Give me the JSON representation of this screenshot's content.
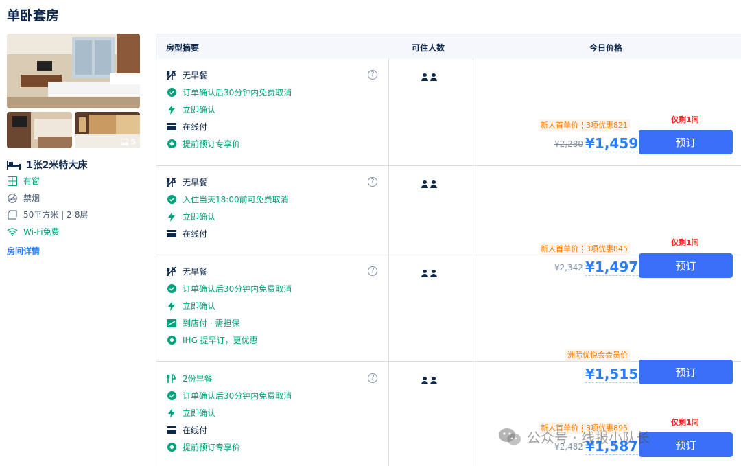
{
  "room": {
    "title": "单卧套房",
    "photo_count": "5",
    "bed": "1张2米特大床",
    "features": [
      "有窗",
      "禁烟",
      "50平方米 | 2-8层",
      "Wi-Fi免费"
    ],
    "detail_link": "房间详情"
  },
  "table": {
    "headers": [
      "房型摘要",
      "可住人数",
      "今日价格"
    ]
  },
  "rates": [
    {
      "policies": [
        {
          "icon": "no-breakfast-icon",
          "text": "无早餐",
          "style": "dark"
        },
        {
          "icon": "check-circle-icon",
          "text": "订单确认后30分钟内免费取消",
          "style": "green"
        },
        {
          "icon": "lightning-icon",
          "text": "立即确认",
          "style": "green"
        },
        {
          "icon": "card-icon",
          "text": "在线付",
          "style": "dark"
        },
        {
          "icon": "coupon-icon",
          "text": "提前预订专享价",
          "style": "green"
        }
      ],
      "promo": [
        "新人首单价",
        "3项优惠821"
      ],
      "original_price": "¥2,280",
      "price": "¥1,459",
      "rooms_left": "仅剩1间",
      "book": "预订"
    },
    {
      "policies": [
        {
          "icon": "no-breakfast-icon",
          "text": "无早餐",
          "style": "dark"
        },
        {
          "icon": "check-circle-icon",
          "text": "入住当天18:00前可免费取消",
          "style": "green"
        },
        {
          "icon": "lightning-icon",
          "text": "立即确认",
          "style": "green"
        },
        {
          "icon": "card-icon",
          "text": "在线付",
          "style": "dark"
        }
      ],
      "promo": [
        "新人首单价",
        "3项优惠845"
      ],
      "original_price": "¥2,342",
      "price": "¥1,497",
      "rooms_left": "仅剩1间",
      "book": "预订"
    },
    {
      "policies": [
        {
          "icon": "no-breakfast-icon",
          "text": "无早餐",
          "style": "dark"
        },
        {
          "icon": "check-circle-icon",
          "text": "订单确认后30分钟内免费取消",
          "style": "green"
        },
        {
          "icon": "lightning-icon",
          "text": "立即确认",
          "style": "green"
        },
        {
          "icon": "pay-at-hotel-icon",
          "text": "到店付 · 需担保",
          "style": "green"
        },
        {
          "icon": "coupon-icon",
          "text": "IHG 提早订，更优惠",
          "style": "green"
        }
      ],
      "promo": [
        "洲际优悦会会员价"
      ],
      "price": "¥1,515",
      "book": "预订"
    },
    {
      "policies": [
        {
          "icon": "breakfast-icon",
          "text": "2份早餐",
          "style": "green"
        },
        {
          "icon": "check-circle-icon",
          "text": "订单确认后30分钟内免费取消",
          "style": "green"
        },
        {
          "icon": "lightning-icon",
          "text": "立即确认",
          "style": "green"
        },
        {
          "icon": "card-icon",
          "text": "在线付",
          "style": "dark"
        },
        {
          "icon": "coupon-icon",
          "text": "提前预订专享价",
          "style": "green"
        }
      ],
      "promo": [
        "新人首单价",
        "3项优惠895"
      ],
      "original_price": "¥2,482",
      "price": "¥1,587",
      "rooms_left": "仅剩1间",
      "book": "预订"
    }
  ],
  "watermark": "公众号 · 线报小队长",
  "colors": {
    "accent": "#287dfa",
    "button": "#3a6ff7",
    "green": "#00a27c",
    "orange": "#ff7a00",
    "red": "#ff2020"
  }
}
